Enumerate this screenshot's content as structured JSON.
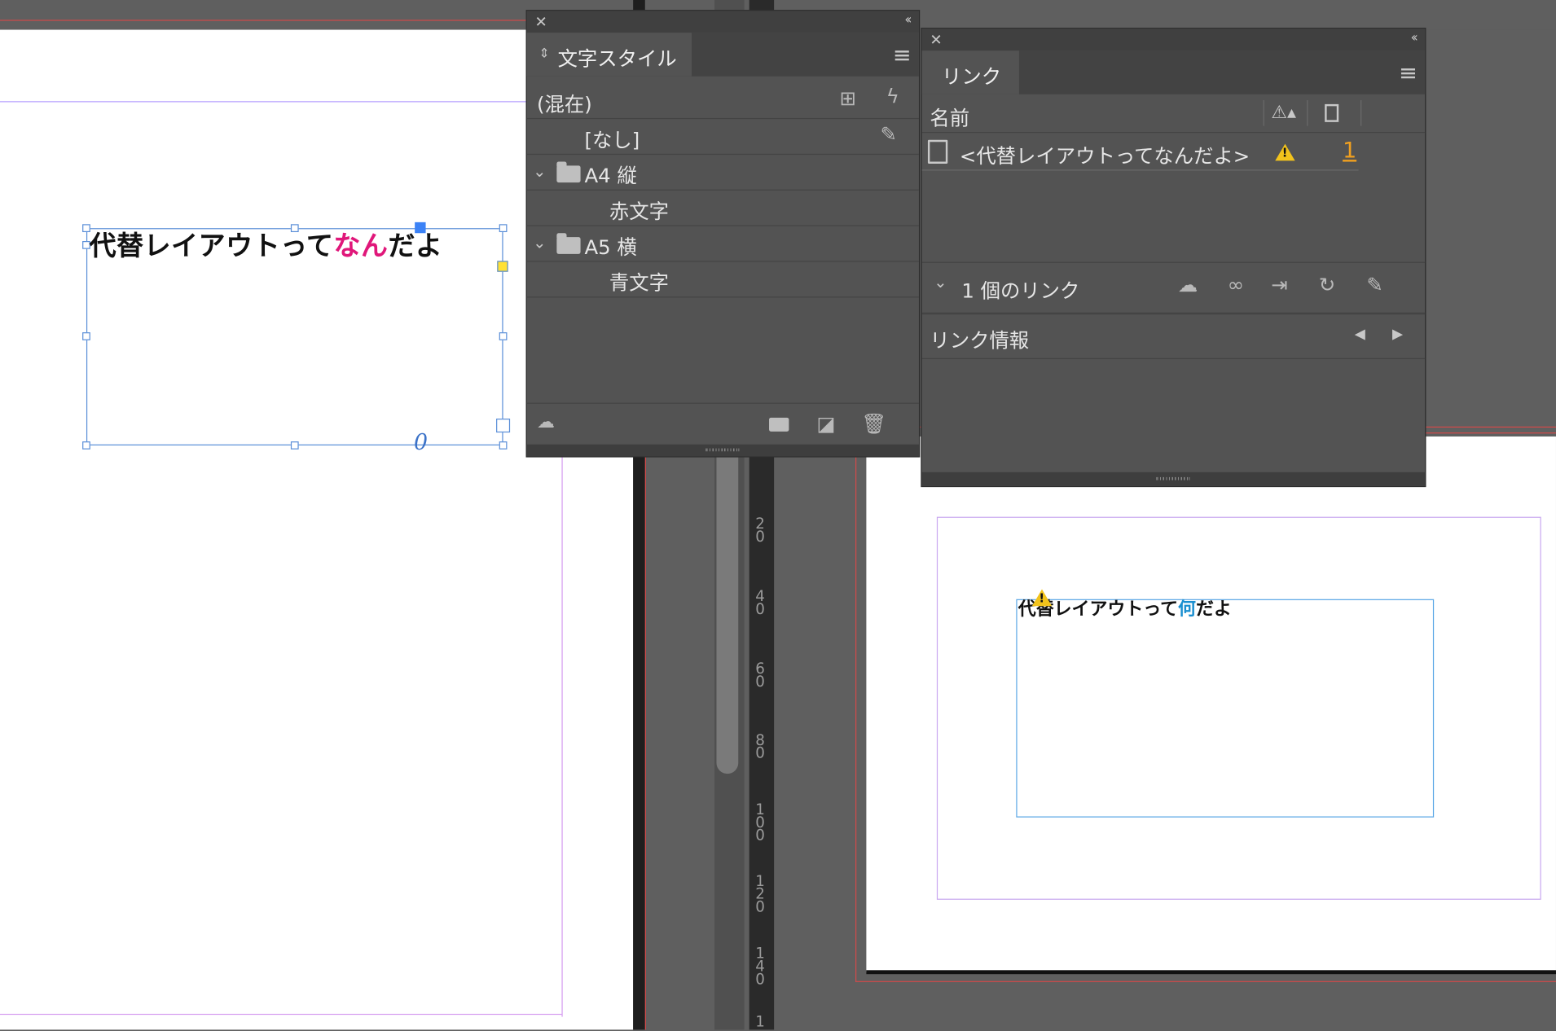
{
  "character_styles_panel": {
    "title": "文字スタイル",
    "current_label": "(混在)",
    "items": [
      {
        "label": "[なし]"
      },
      {
        "label": "A4 縦"
      },
      {
        "label": "赤文字"
      },
      {
        "label": "A5 横"
      },
      {
        "label": "青文字"
      }
    ]
  },
  "links_panel": {
    "title": "リンク",
    "column_name": "名前",
    "link_name": "<代替レイアウトってなんだよ>",
    "link_page": "1",
    "link_count": "1 個のリンク",
    "link_info": "リンク情報"
  },
  "left_page": {
    "text_prefix": "代替レイアウトって",
    "text_highlight": "なん",
    "text_suffix": "だよ",
    "overset_glyph": "0"
  },
  "right_page": {
    "text_prefix": "代替レイアウトって",
    "text_highlight": "何",
    "text_suffix": "だよ"
  },
  "ruler": {
    "labels": [
      "20",
      "40",
      "60",
      "80",
      "100",
      "120",
      "140",
      "1"
    ]
  },
  "colors": {
    "highlight_left": "#e0177a",
    "highlight_right": "#1a8fd0",
    "warning": "#f2c31c",
    "page_number": "#f0a020"
  }
}
